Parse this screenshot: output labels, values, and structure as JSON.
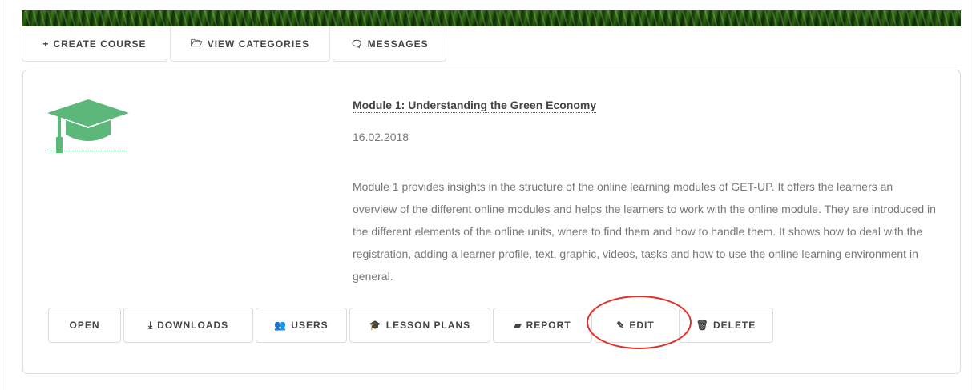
{
  "tabs": {
    "create_course": {
      "icon": "+",
      "label": "CREATE COURSE"
    },
    "view_categories": {
      "icon": "🗁",
      "label": "VIEW CATEGORIES"
    },
    "messages": {
      "icon": "🗨",
      "label": "MESSAGES"
    }
  },
  "course": {
    "title": "Module 1: Understanding the Green Economy",
    "date": "16.02.2018",
    "description": "Module 1 provides insights in the structure of the online learning modules of GET-UP. It offers the learners an overview of the different online modules and helps the learners to work with the online module. They are introduced in the different elements of the online units, where to find them and how to handle them. It shows how to deal with the registration, adding a learner profile, text, graphic, videos, tasks and how to use the online learning environment in general.",
    "image_icon": "graduation-cap-icon",
    "image_color": "#5cb87a"
  },
  "actions": {
    "open": {
      "label": "OPEN"
    },
    "downloads": {
      "icon": "⤓",
      "label": "DOWNLOADS"
    },
    "users": {
      "icon": "👥",
      "label": "USERS"
    },
    "lesson_plans": {
      "icon": "🎓",
      "label": "LESSON PLANS"
    },
    "report": {
      "icon": "▰",
      "label": "REPORT"
    },
    "edit": {
      "icon": "✎",
      "label": "EDIT"
    },
    "delete": {
      "icon": "🗑",
      "label": "DELETE"
    }
  },
  "annotation": {
    "color": "#e0312b",
    "target": "edit"
  }
}
